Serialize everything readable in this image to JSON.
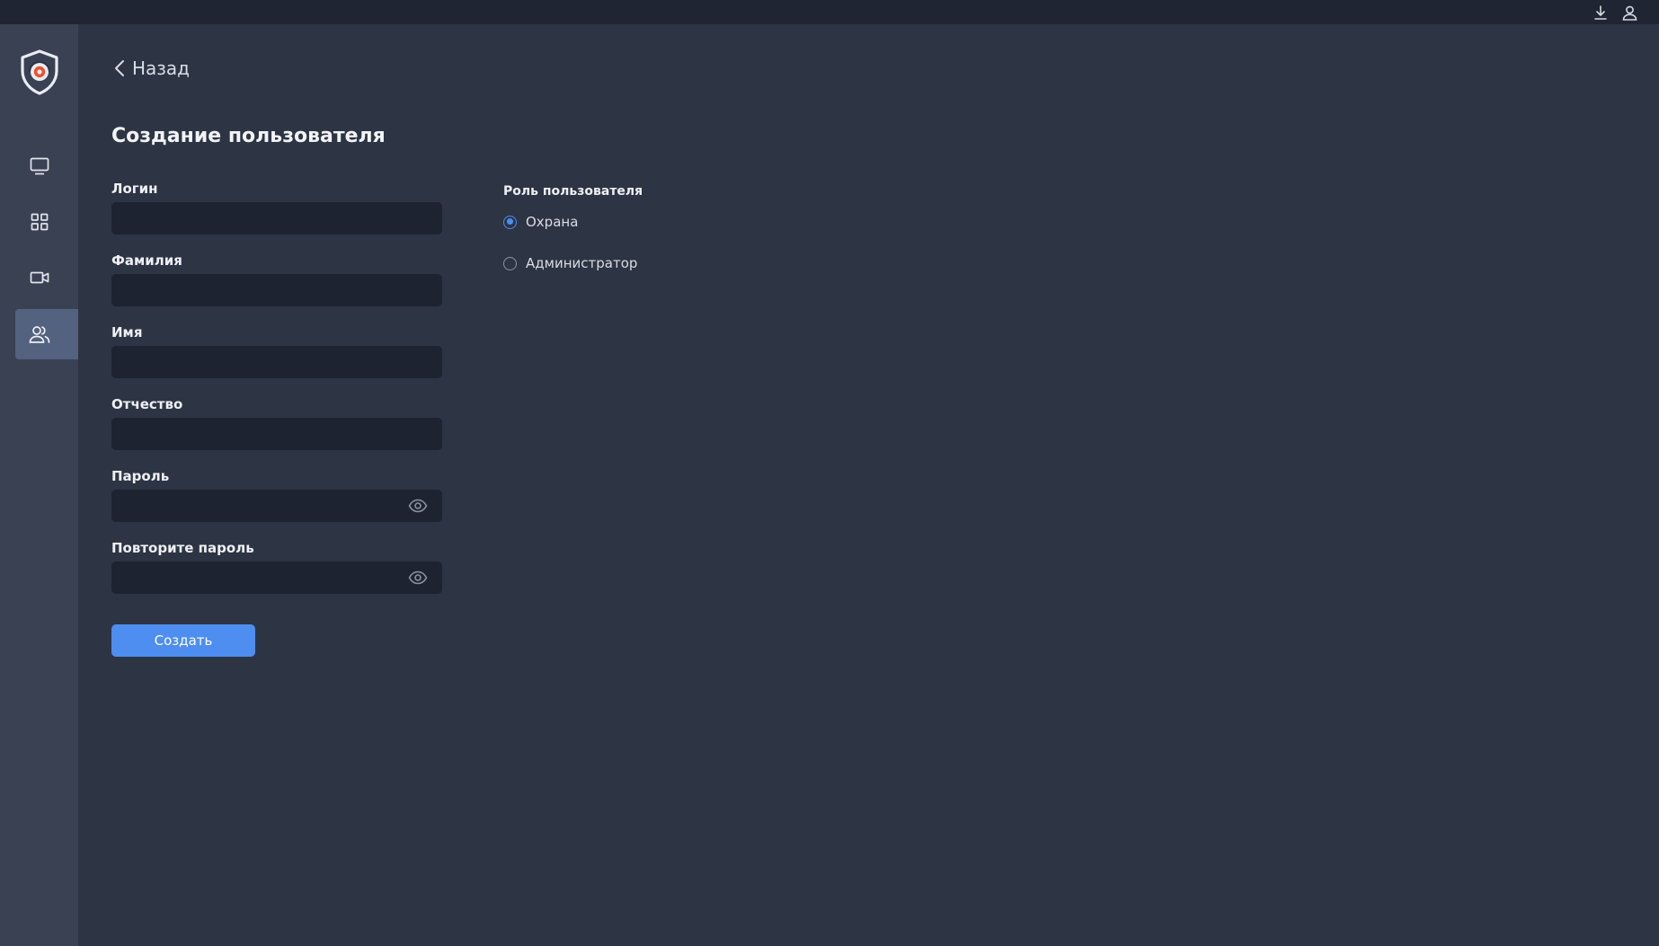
{
  "header": {
    "icons": [
      "download-icon",
      "user-icon"
    ]
  },
  "sidebar": {
    "logo": "shield-logo",
    "items": [
      {
        "icon": "monitor-icon",
        "active": false
      },
      {
        "icon": "grid-icon",
        "active": false
      },
      {
        "icon": "video-camera-icon",
        "active": false
      },
      {
        "icon": "users-icon",
        "active": true
      }
    ]
  },
  "page": {
    "back_label": "Назад",
    "title": "Создание пользователя"
  },
  "form": {
    "login_label": "Логин",
    "login_value": "",
    "lastname_label": "Фамилия",
    "lastname_value": "",
    "firstname_label": "Имя",
    "firstname_value": "",
    "patronymic_label": "Отчество",
    "patronymic_value": "",
    "password_label": "Пароль",
    "password_value": "",
    "repeat_password_label": "Повторите пароль",
    "repeat_password_value": "",
    "submit_label": "Создать"
  },
  "role": {
    "title": "Роль пользователя",
    "options": [
      {
        "label": "Охрана",
        "selected": true
      },
      {
        "label": "Администратор",
        "selected": false
      }
    ]
  },
  "colors": {
    "background": "#2d3444",
    "sidebar": "#394153",
    "sidebar_active": "#53627f",
    "input_bg": "#1d2331",
    "accent": "#4d8ef0",
    "logo_accent": "#e8542c"
  }
}
